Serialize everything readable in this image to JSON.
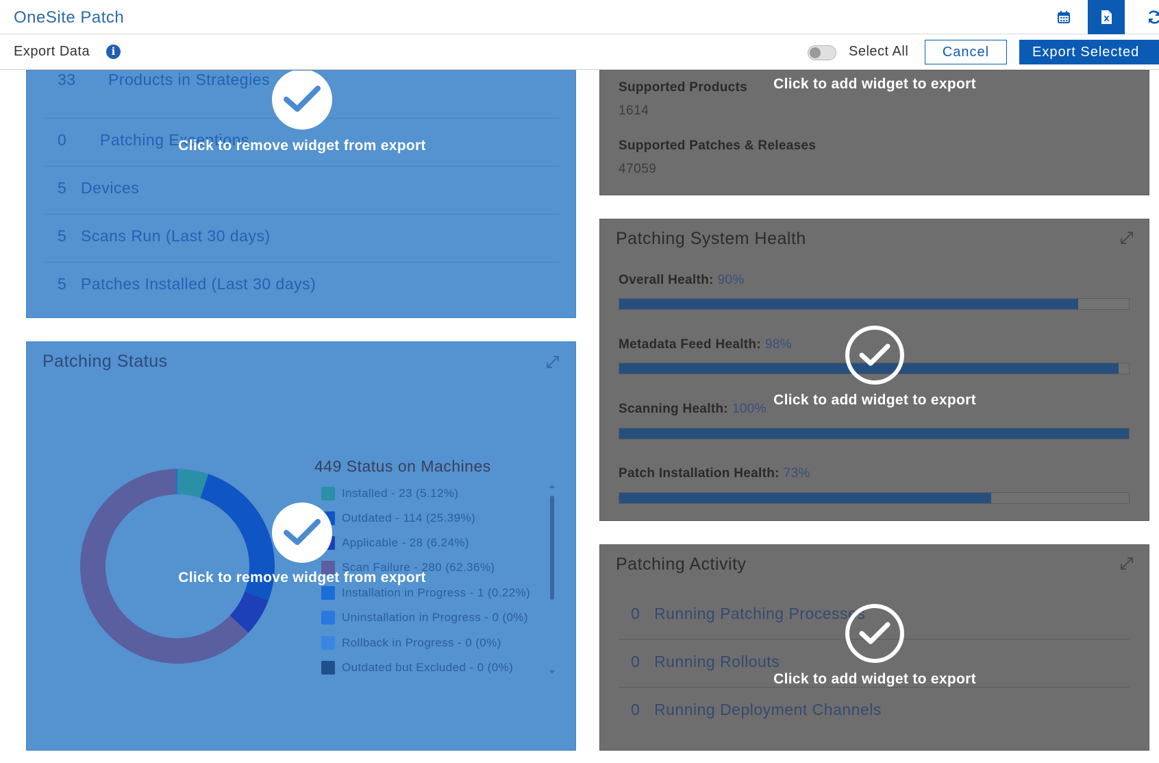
{
  "app": {
    "title": "OneSite Patch"
  },
  "toolbar": {
    "calendar_icon": "calendar-icon",
    "excel_icon": "excel-export-icon",
    "refresh_icon": "refresh-icon"
  },
  "export_bar": {
    "label": "Export Data",
    "info_glyph": "i",
    "select_all_label": "Select All",
    "select_all_on": false,
    "cancel_label": "Cancel",
    "export_label": "Export Selected"
  },
  "colors": {
    "selected_widget": "#5492d0",
    "unselected_widget": "#6e6e6e",
    "primary": "#0b5bb5"
  },
  "summary_widget": {
    "state": "selected",
    "overlay_text": "Click to remove widget from export",
    "rows": [
      {
        "count": "33",
        "label": "Products in Strategies"
      },
      {
        "count": "0",
        "label": "Patching Exceptions"
      },
      {
        "count": "5",
        "label": "Devices"
      },
      {
        "count": "5",
        "label": "Scans Run (Last 30 days)"
      },
      {
        "count": "5",
        "label": "Patches Installed (Last 30 days)"
      }
    ]
  },
  "status_widget": {
    "state": "selected",
    "title": "Patching Status",
    "overlay_text": "Click to remove widget from export",
    "legend_title": "449 Status on Machines",
    "legend": [
      {
        "label": "Installed - 23 (5.12%)",
        "color": "#2b8fa8"
      },
      {
        "label": "Outdated - 114 (25.39%)",
        "color": "#0f56c4"
      },
      {
        "label": "Applicable - 28 (6.24%)",
        "color": "#1d3fb8"
      },
      {
        "label": "Scan Failure - 280 (62.36%)",
        "color": "#5a5fa0"
      },
      {
        "label": "Installation in Progress - 1 (0.22%)",
        "color": "#1a6ed8"
      },
      {
        "label": "Uninstallation in Progress - 0 (0%)",
        "color": "#2779e0"
      },
      {
        "label": "Rollback in Progress - 0 (0%)",
        "color": "#3b86e0"
      },
      {
        "label": "Outdated but Excluded - 0 (0%)",
        "color": "#1f4f8c"
      }
    ]
  },
  "chart_data": {
    "type": "pie",
    "title": "449 Status on Machines",
    "categories": [
      "Installed",
      "Outdated",
      "Applicable",
      "Scan Failure",
      "Installation in Progress",
      "Uninstallation in Progress",
      "Rollback in Progress",
      "Outdated but Excluded"
    ],
    "values": [
      23,
      114,
      28,
      280,
      1,
      0,
      0,
      0
    ],
    "percentages": [
      5.12,
      25.39,
      6.24,
      62.36,
      0.22,
      0,
      0,
      0
    ],
    "colors": [
      "#2b8fa8",
      "#0f56c4",
      "#1d3fb8",
      "#5a5fa0",
      "#1a6ed8",
      "#2779e0",
      "#3b86e0",
      "#1f4f8c"
    ],
    "donut": true,
    "legend_position": "right"
  },
  "support_widget": {
    "state": "unselected",
    "overlay_text": "Click to add widget to export",
    "items": [
      {
        "label": "Supported Products",
        "value": "1614"
      },
      {
        "label": "Supported Patches & Releases",
        "value": "47059"
      }
    ]
  },
  "health_widget": {
    "state": "unselected",
    "title": "Patching System Health",
    "overlay_text": "Click to add widget to export",
    "items": [
      {
        "label": "Overall Health:",
        "value": "90%",
        "level": 0.9
      },
      {
        "label": "Metadata Feed Health:",
        "value": "98%",
        "level": 0.98
      },
      {
        "label": "Scanning Health:",
        "value": "100%",
        "level": 1.0
      },
      {
        "label": "Patch Installation Health:",
        "value": "73%",
        "level": 0.73
      }
    ]
  },
  "activity_widget": {
    "state": "unselected",
    "title": "Patching Activity",
    "overlay_text": "Click to add widget to export",
    "rows": [
      {
        "count": "0",
        "label": "Running Patching Processes"
      },
      {
        "count": "0",
        "label": "Running Rollouts"
      },
      {
        "count": "0",
        "label": "Running Deployment Channels"
      }
    ]
  }
}
